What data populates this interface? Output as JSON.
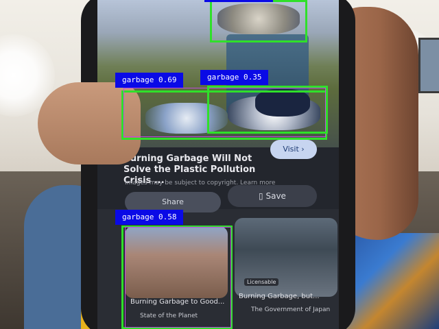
{
  "detections": [
    {
      "label": "garbage 0.69"
    },
    {
      "label": "garbage 0.35"
    },
    {
      "label": "garbage 0.58"
    }
  ],
  "phone": {
    "top_result": {
      "title": "Burning Garbage Will Not Solve the Plastic Pollution Crisis ...",
      "subtitle": "Images may be subject to copyright. Learn more",
      "visit_label": "Visit",
      "share_label": "Share",
      "save_label": "Save"
    },
    "related": [
      {
        "title": "Burning Garbage to Good...",
        "source": "State of the Planet"
      },
      {
        "badge": "Licensable",
        "title": "Burning Garbage, but...",
        "source": "The Government of Japan"
      }
    ]
  },
  "colors": {
    "bbox": "#2fe02a",
    "label_bg": "#0a0ae6",
    "label_text": "#ffffff"
  }
}
